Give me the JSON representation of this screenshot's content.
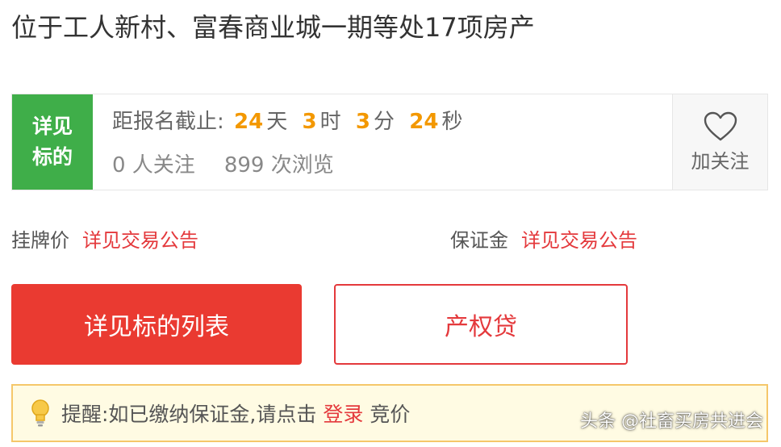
{
  "title": "位于工人新村、富春商业城一期等处17项房产",
  "badge": {
    "text": "详见标的"
  },
  "countdown": {
    "label": "距报名截止:",
    "days": "24",
    "days_unit": "天",
    "hours": "3",
    "hours_unit": "时",
    "minutes": "3",
    "minutes_unit": "分",
    "seconds": "24",
    "seconds_unit": "秒"
  },
  "stats": {
    "followers": "0 人关注",
    "views": "899 次浏览"
  },
  "follow": {
    "label": "加关注",
    "icon": "heart-icon"
  },
  "listing_price": {
    "label": "挂牌价",
    "value": "详见交易公告"
  },
  "deposit": {
    "label": "保证金",
    "value": "详见交易公告"
  },
  "buttons": {
    "primary": "详见标的列表",
    "secondary": "产权贷"
  },
  "notice": {
    "prefix": "提醒:如已缴纳保证金,请点击",
    "login": "登录",
    "suffix": "竞价",
    "icon": "lightbulb-icon"
  },
  "watermark": "头条 @社畜买房共进会",
  "colors": {
    "badge_green": "#3fae49",
    "countdown_orange": "#f39800",
    "accent_red": "#e4393c",
    "primary_button": "#ea3a31",
    "notice_bg": "#fffbe3",
    "notice_border": "#f5c76a"
  }
}
